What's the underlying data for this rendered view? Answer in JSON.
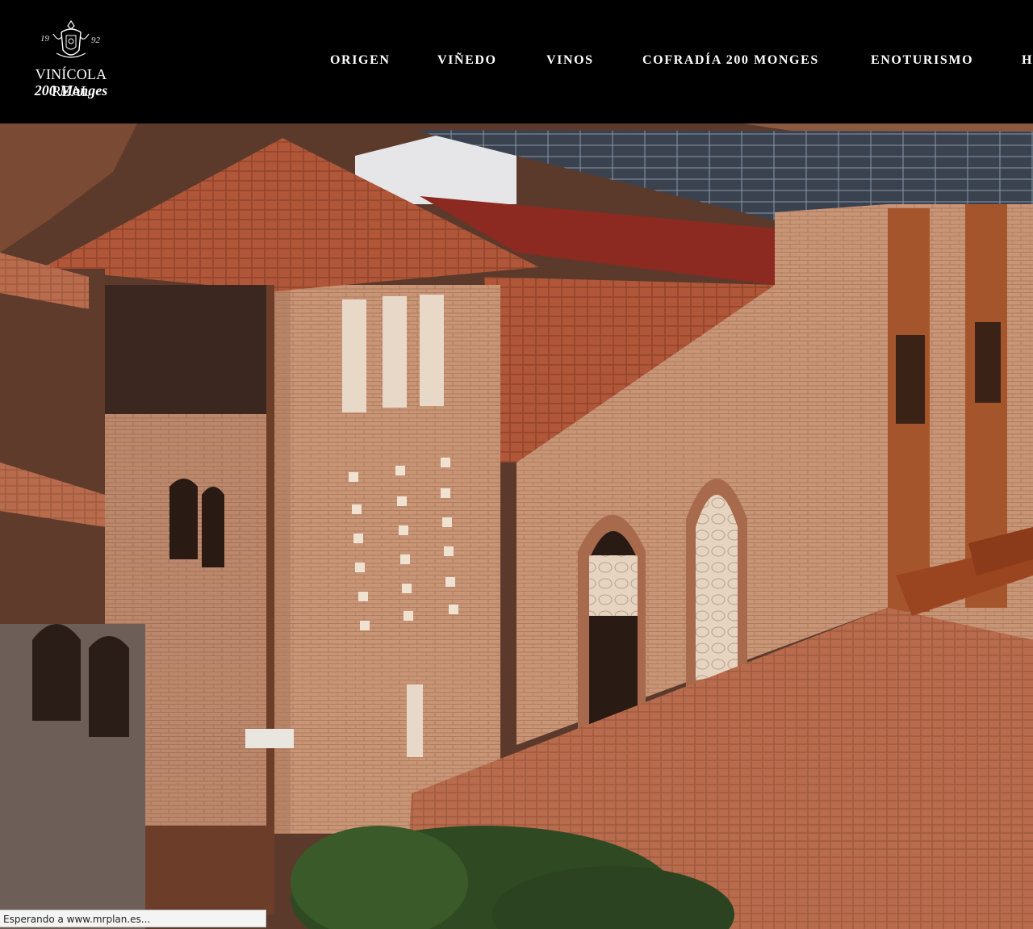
{
  "logo": {
    "year_left": "19",
    "year_right": "92",
    "name_line1": "VINÍCOLA REAL",
    "name_line2": "200 Monges"
  },
  "nav": {
    "items": [
      {
        "label": "ORIGEN"
      },
      {
        "label": "VIÑEDO"
      },
      {
        "label": "VINOS"
      },
      {
        "label": "COFRADÍA 200 MONGES"
      },
      {
        "label": "ENOTURISMO"
      },
      {
        "label": "H"
      }
    ]
  },
  "hero": {
    "description_visible": false
  },
  "status_bar": {
    "text": "Esperando a www.mrplan.es..."
  },
  "colors": {
    "header_bg": "#000000",
    "nav_text": "#ffffff",
    "roof_tile": "#b8532e",
    "brick": "#c98f72"
  }
}
